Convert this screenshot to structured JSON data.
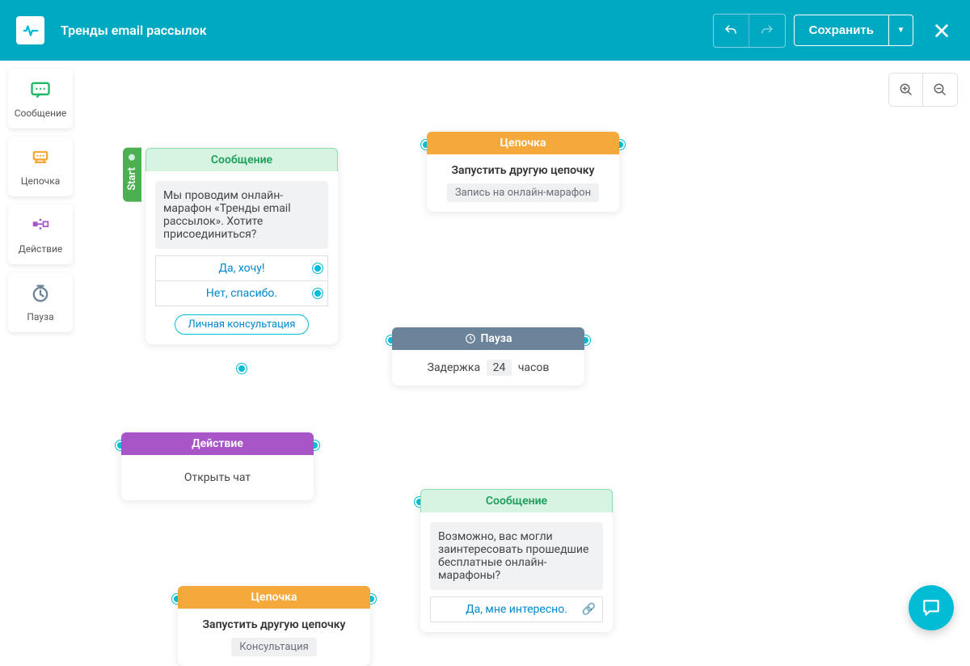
{
  "header": {
    "title": "Тренды email рассылок",
    "save": "Сохранить"
  },
  "sidebar": {
    "message": "Сообщение",
    "chain": "Цепочка",
    "action": "Действие",
    "pause": "Пауза"
  },
  "start_label": "Start",
  "nodes": {
    "n1": {
      "title": "Сообщение",
      "text": "Мы проводим онлайн-марафон «Тренды email рассылок». Хотите присоединиться?",
      "opt1": "Да, хочу!",
      "opt2": "Нет, спасибо.",
      "chip": "Личная консультация"
    },
    "n2": {
      "title": "Цепочка",
      "sub": "Запустить другую цепочку",
      "tag": "Запись на онлайн-марафон"
    },
    "n3": {
      "title": "Пауза",
      "prefix": "Задержка",
      "value": "24",
      "suffix": "часов"
    },
    "n4": {
      "title": "Действие",
      "text": "Открыть чат"
    },
    "n5": {
      "title": "Сообщение",
      "text": "Возможно, вас могли заинтересовать прошедшие бесплатные онлайн-марафоны?",
      "opt1": "Да, мне интересно."
    },
    "n6": {
      "title": "Цепочка",
      "sub": "Запустить другую цепочку",
      "tag": "Консультация"
    }
  }
}
